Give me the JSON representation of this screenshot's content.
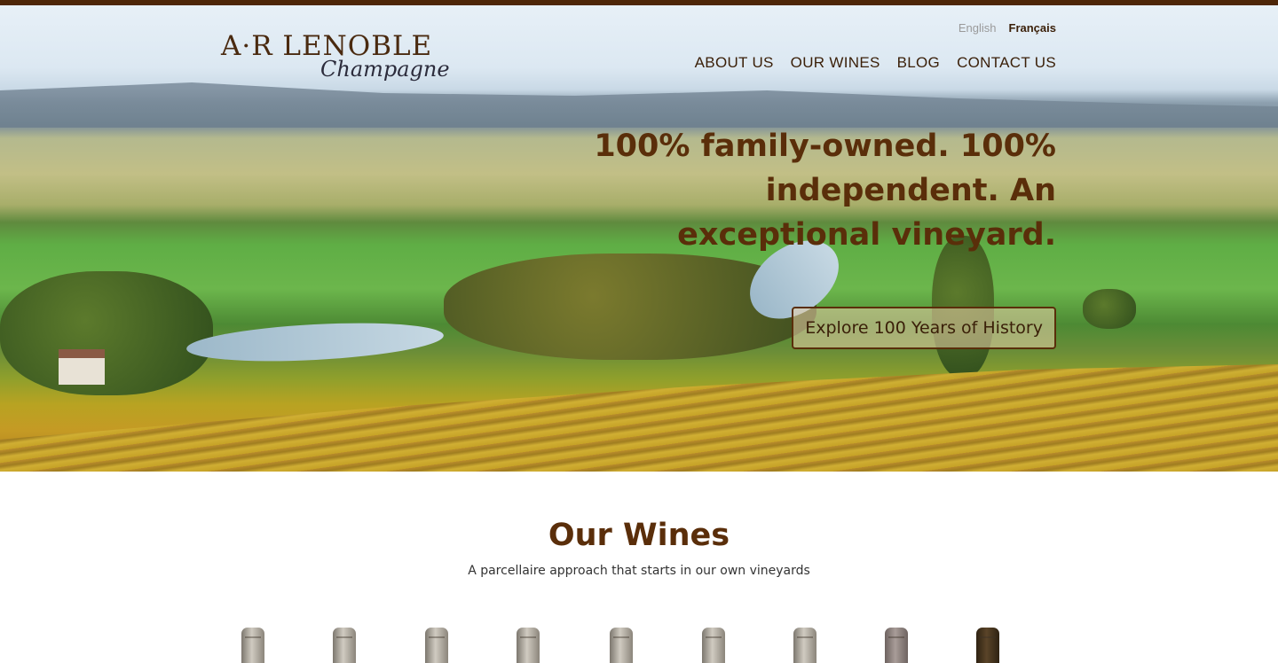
{
  "brand": {
    "logo_main": "A·R LENOBLE",
    "logo_sub": "Champagne"
  },
  "languages": {
    "english": "English",
    "french": "Français",
    "active": "Français"
  },
  "nav": {
    "items": [
      {
        "label": "ABOUT US"
      },
      {
        "label": "OUR WINES"
      },
      {
        "label": "BLOG"
      },
      {
        "label": "CONTACT US"
      }
    ]
  },
  "hero": {
    "headline": "100% family-owned. 100% independent. An exceptional vineyard.",
    "cta_label": "Explore 100 Years of History"
  },
  "wines_section": {
    "title": "Our Wines",
    "subtitle": "A parcellaire approach that starts in our own vineyards",
    "bottle_count": 9
  },
  "colors": {
    "accent": "#5a2e0a",
    "top_bar": "#4d2608",
    "nav_text": "#3a1f08"
  }
}
